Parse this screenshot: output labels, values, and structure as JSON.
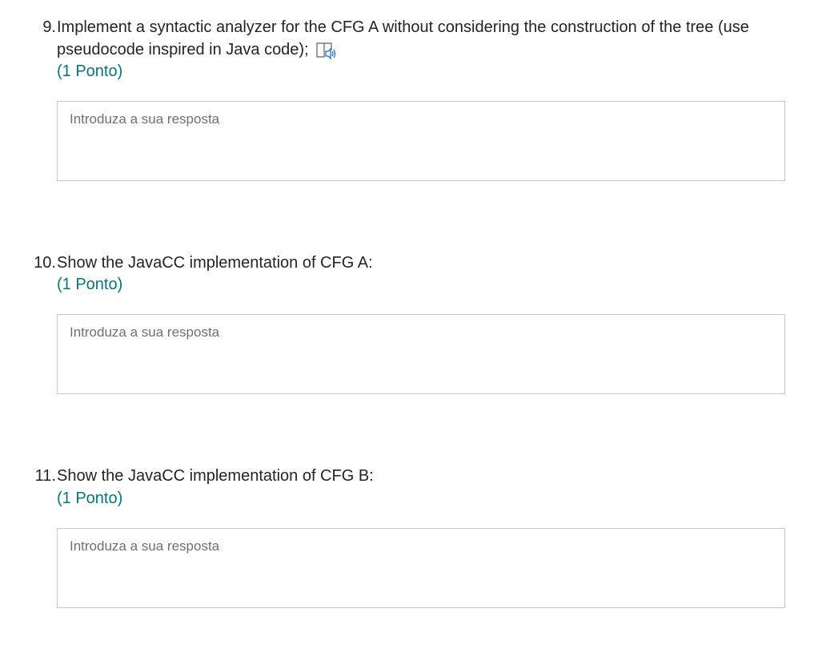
{
  "questions": [
    {
      "number": "9.",
      "title": "Implement a syntactic analyzer for the CFG A without considering the construction of the tree (use pseudocode inspired in Java code);",
      "points": "(1 Ponto)",
      "placeholder": "Introduza a sua resposta",
      "has_reader_icon": true
    },
    {
      "number": "10.",
      "title": "Show the JavaCC implementation of CFG A:",
      "points": "(1 Ponto)",
      "placeholder": "Introduza a sua resposta",
      "has_reader_icon": false
    },
    {
      "number": "11.",
      "title": "Show the JavaCC implementation of CFG B:",
      "points": "(1 Ponto)",
      "placeholder": "Introduza a sua resposta",
      "has_reader_icon": false
    }
  ],
  "colors": {
    "points": "#03787c",
    "text": "#242424",
    "placeholder": "#707070",
    "border": "#c8c8c8",
    "reader_icon": "#0f6cbd"
  },
  "icons": {
    "reader": "immersive-reader-icon"
  }
}
